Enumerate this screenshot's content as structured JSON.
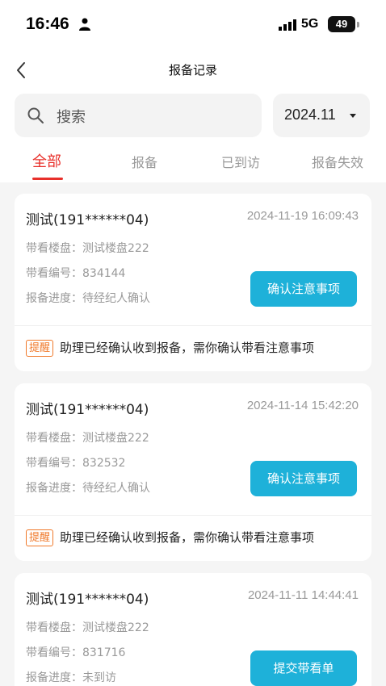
{
  "status_bar": {
    "time": "16:46",
    "network": "5G",
    "battery": "49"
  },
  "nav": {
    "title": "报备记录"
  },
  "search": {
    "placeholder": "搜索"
  },
  "date_filter": {
    "value": "2024.11"
  },
  "tabs": [
    {
      "label": "全部",
      "active": true
    },
    {
      "label": "报备",
      "active": false
    },
    {
      "label": "已到访",
      "active": false
    },
    {
      "label": "报备失效",
      "active": false
    }
  ],
  "labels": {
    "estate": "带看楼盘：",
    "code": "带看编号：",
    "progress": "报备进度："
  },
  "records": [
    {
      "name": "测试(191******04)",
      "time": "2024-11-19 16:09:43",
      "estate": "测试楼盘222",
      "code": "834144",
      "progress": "待经纪人确认",
      "action": "确认注意事项",
      "reminder_tag": "提醒",
      "reminder": "助理已经确认收到报备，需你确认带看注意事项"
    },
    {
      "name": "测试(191******04)",
      "time": "2024-11-14 15:42:20",
      "estate": "测试楼盘222",
      "code": "832532",
      "progress": "待经纪人确认",
      "action": "确认注意事项",
      "reminder_tag": "提醒",
      "reminder": "助理已经确认收到报备，需你确认带看注意事项"
    },
    {
      "name": "测试(191******04)",
      "time": "2024-11-11 14:44:41",
      "estate": "测试楼盘222",
      "code": "831716",
      "progress": "未到访",
      "action": "提交带看单"
    }
  ],
  "colors": {
    "accent": "#e8302b",
    "button": "#1eb1d9",
    "reminder_tag": "#f0792a"
  },
  "icons": [
    "person-icon",
    "signal-icon",
    "back-icon",
    "search-icon",
    "caret-down-icon"
  ]
}
